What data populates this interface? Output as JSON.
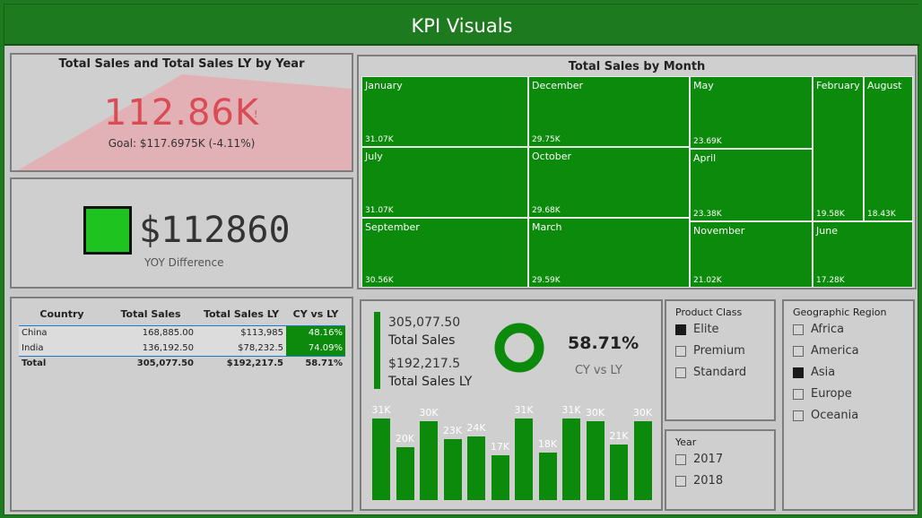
{
  "header": {
    "title": "KPI Visuals"
  },
  "kpi": {
    "title": "Total Sales and Total Sales LY by Year",
    "value": "112.86K",
    "indicator": "!",
    "goal": "Goal: $117.6975K (-4.11%)"
  },
  "card": {
    "value": "$112860",
    "label": "YOY Difference",
    "color": "#1fc31f"
  },
  "treemap": {
    "title": "Total Sales by Month",
    "cells": [
      {
        "month": "January",
        "value": "31.07K"
      },
      {
        "month": "December",
        "value": "29.75K"
      },
      {
        "month": "May",
        "value": "23.69K"
      },
      {
        "month": "February",
        "value": "19.58K"
      },
      {
        "month": "August",
        "value": "18.43K"
      },
      {
        "month": "July",
        "value": "31.07K"
      },
      {
        "month": "October",
        "value": "29.68K"
      },
      {
        "month": "April",
        "value": "23.38K"
      },
      {
        "month": "September",
        "value": "30.56K"
      },
      {
        "month": "March",
        "value": "29.59K"
      },
      {
        "month": "November",
        "value": "21.02K"
      },
      {
        "month": "June",
        "value": "17.28K"
      }
    ]
  },
  "table": {
    "headers": [
      "Country",
      "Total Sales",
      "Total Sales LY",
      "CY vs LY"
    ],
    "rows": [
      [
        "China",
        "168,885.00",
        "$113,985",
        "48.16%"
      ],
      [
        "India",
        "136,192.50",
        "$78,232.5",
        "74.09%"
      ]
    ],
    "total": [
      "Total",
      "305,077.50",
      "$192,217.5",
      "58.71%"
    ]
  },
  "multi_card": {
    "total_sales": "305,077.50",
    "total_sales_label": "Total Sales",
    "total_sales_ly": "$192,217.5",
    "total_sales_ly_label": "Total Sales LY",
    "cy_vs_ly": "58.71%",
    "cy_vs_ly_label": "CY vs LY"
  },
  "chart_data": {
    "type": "bar",
    "values": [
      31,
      20,
      30,
      23,
      24,
      17,
      31,
      18,
      31,
      30,
      21,
      30
    ],
    "labels": [
      "31K",
      "20K",
      "30K",
      "23K",
      "24K",
      "17K",
      "31K",
      "18K",
      "31K",
      "30K",
      "21K",
      "30K"
    ],
    "ylim": [
      0,
      34
    ],
    "color": "#0b8a0b"
  },
  "slicers": {
    "product_class": {
      "title": "Product Class",
      "options": [
        {
          "label": "Elite",
          "checked": true
        },
        {
          "label": "Premium",
          "checked": false
        },
        {
          "label": "Standard",
          "checked": false
        }
      ]
    },
    "year": {
      "title": "Year",
      "options": [
        {
          "label": "2017",
          "checked": false
        },
        {
          "label": "2018",
          "checked": false
        }
      ]
    },
    "region": {
      "title": "Geographic Region",
      "options": [
        {
          "label": "Africa",
          "checked": false
        },
        {
          "label": "America",
          "checked": false
        },
        {
          "label": "Asia",
          "checked": true
        },
        {
          "label": "Europe",
          "checked": false
        },
        {
          "label": "Oceania",
          "checked": false
        }
      ]
    }
  }
}
